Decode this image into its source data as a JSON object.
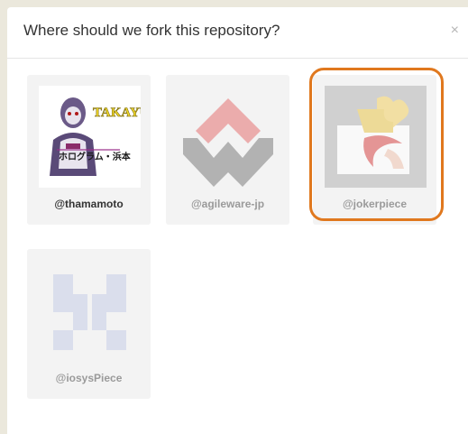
{
  "modal": {
    "title": "Where should we fork this repository?",
    "close_glyph": "×"
  },
  "accounts": [
    {
      "handle": "@thamamoto",
      "avatar": "thamamoto-avatar",
      "state": "selectable"
    },
    {
      "handle": "@agileware-jp",
      "avatar": "agileware-logo",
      "state": "disabled"
    },
    {
      "handle": "@jokerpiece",
      "avatar": "puzzle-piece-avatar",
      "state": "disabled"
    },
    {
      "handle": "@iosysPiece",
      "avatar": "identicon-avatar",
      "state": "disabled"
    }
  ],
  "avatar_text": {
    "thamamoto_line1": "TAKAYUKI",
    "thamamoto_line2": "ホログラム・浜本"
  },
  "colors": {
    "highlight": "#e0781e",
    "tile_bg": "#f3f3f3",
    "agileware_red": "#e88a8a",
    "agileware_gray": "#8c8c8c",
    "identicon": "#c7cde8"
  }
}
